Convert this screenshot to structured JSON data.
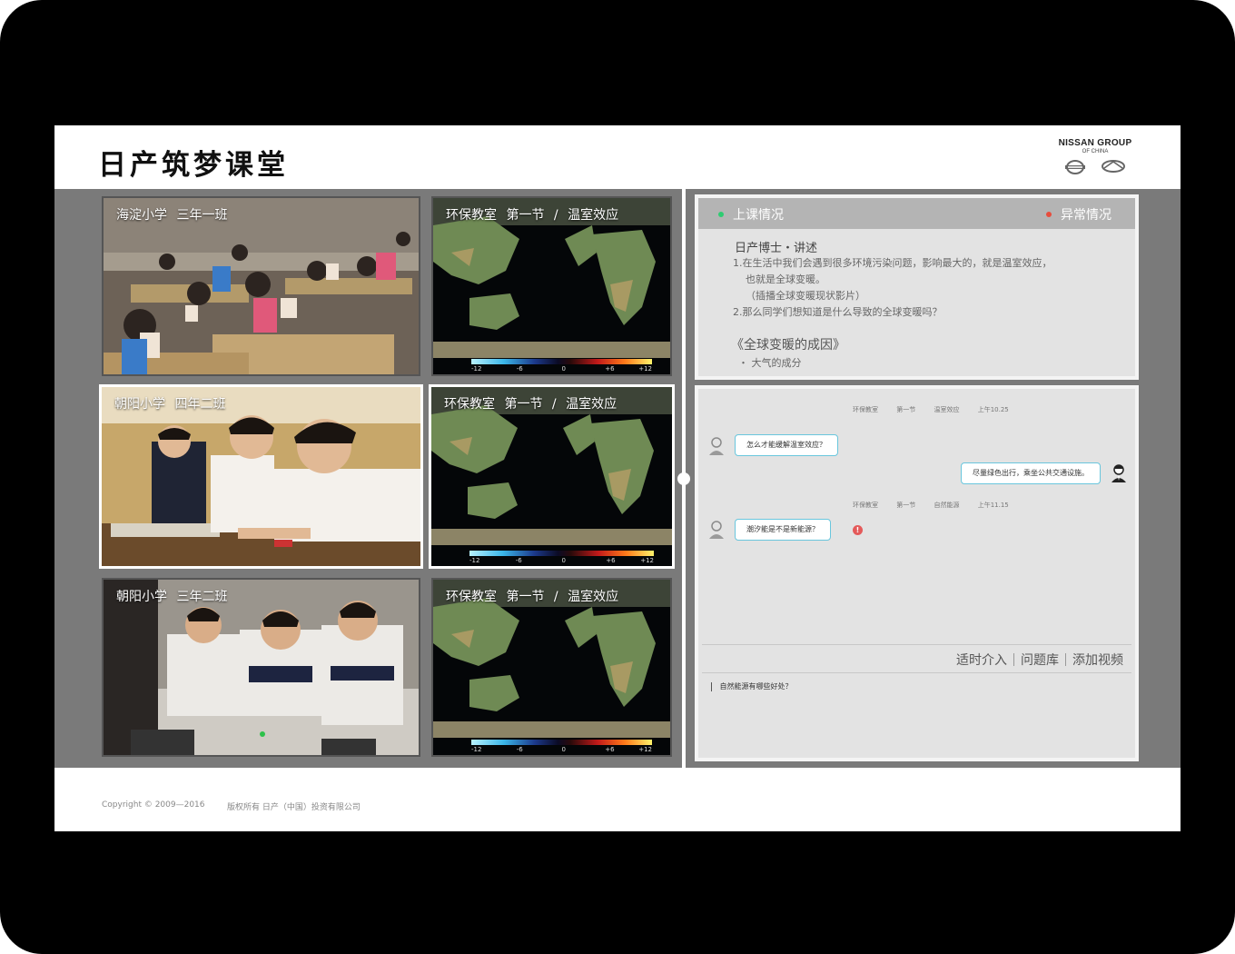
{
  "header": {
    "title": "日产筑梦课堂",
    "logo_line1": "NISSAN GROUP",
    "logo_line2": "OF CHINA",
    "logo_marks": [
      "nissan-logo-icon",
      "infiniti-logo-icon"
    ]
  },
  "classrooms": [
    {
      "school": "海淀小学",
      "class": "三年一班",
      "selected": false
    },
    {
      "school": "朝阳小学",
      "class": "四年二班",
      "selected": true
    },
    {
      "school": "朝阳小学",
      "class": "三年二班",
      "selected": false
    }
  ],
  "lessons": [
    {
      "room": "环保教室",
      "section": "第一节",
      "topic": "温室效应",
      "selected": false
    },
    {
      "room": "环保教室",
      "section": "第一节",
      "topic": "温室效应",
      "selected": true
    },
    {
      "room": "环保教室",
      "section": "第一节",
      "topic": "温室效应",
      "selected": false
    }
  ],
  "separator": "/",
  "colorbar_ticks": [
    "-12",
    "-6",
    "0",
    "+6",
    "+12"
  ],
  "status": {
    "tab_class": "上课情况",
    "tab_alert": "异常情况",
    "tab_class_color": "#2ecc71",
    "tab_alert_color": "#e74c3c",
    "speaker": "日产博士・讲述",
    "lines": [
      "1.在生活中我们会遇到很多环境污染问题，影响最大的，就是温室效应，",
      "也就是全球变暖。",
      "（插播全球变暖现状影片）",
      "2.那么同学们想知道是什么导致的全球变暖吗？"
    ],
    "subtitle": "《全球变暖的成因》",
    "bullet": "・  大气的成分"
  },
  "chat": {
    "meta1": {
      "room": "环保教室",
      "section": "第一节",
      "topic": "温室效应",
      "time": "上午10.25"
    },
    "msg1": "怎么才能缓解温室效应？",
    "reply1": "尽量绿色出行，乘坐公共交通设施。",
    "meta2": {
      "room": "环保教室",
      "section": "第一节",
      "topic": "自然能源",
      "time": "上午11.15"
    },
    "msg2": "潮汐能是不是新能源？",
    "alert_glyph": "!",
    "actions": [
      "适时介入",
      "问题库",
      "添加视频"
    ],
    "input_value": "自然能源有哪些好处？"
  },
  "footer": {
    "copyright": "Copyright  ©  2009—2016",
    "company": "版权所有  日产（中国）投资有限公司"
  }
}
